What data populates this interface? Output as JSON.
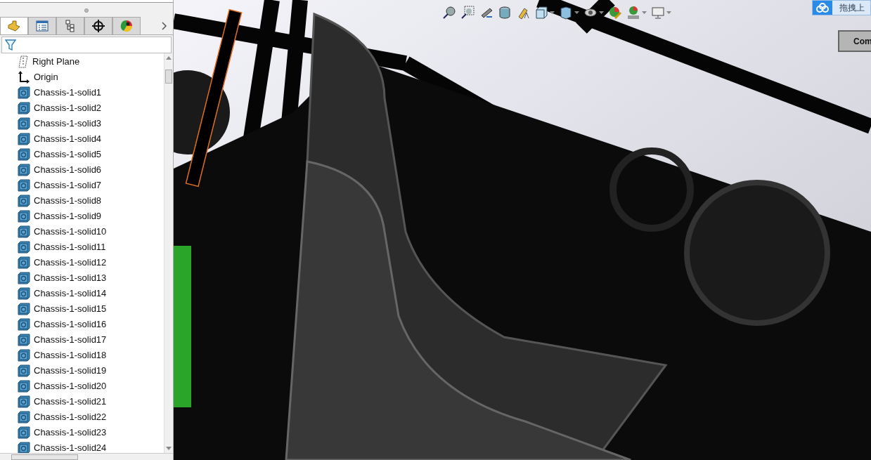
{
  "panel_tabs": [
    {
      "kind": "feature-tree",
      "selected": true
    },
    {
      "kind": "property-manager",
      "selected": false
    },
    {
      "kind": "configuration-manager",
      "selected": false
    },
    {
      "kind": "dimxpert",
      "selected": false
    },
    {
      "kind": "display-manager",
      "selected": false
    }
  ],
  "tree": [
    {
      "kind": "plane",
      "label": "Right Plane"
    },
    {
      "kind": "origin",
      "label": "Origin"
    },
    {
      "kind": "solid",
      "label": "Chassis-1-solid1"
    },
    {
      "kind": "solid",
      "label": "Chassis-1-solid2"
    },
    {
      "kind": "solid",
      "label": "Chassis-1-solid3"
    },
    {
      "kind": "solid",
      "label": "Chassis-1-solid4"
    },
    {
      "kind": "solid",
      "label": "Chassis-1-solid5"
    },
    {
      "kind": "solid",
      "label": "Chassis-1-solid6"
    },
    {
      "kind": "solid",
      "label": "Chassis-1-solid7"
    },
    {
      "kind": "solid",
      "label": "Chassis-1-solid8"
    },
    {
      "kind": "solid",
      "label": "Chassis-1-solid9"
    },
    {
      "kind": "solid",
      "label": "Chassis-1-solid10"
    },
    {
      "kind": "solid",
      "label": "Chassis-1-solid11"
    },
    {
      "kind": "solid",
      "label": "Chassis-1-solid12"
    },
    {
      "kind": "solid",
      "label": "Chassis-1-solid13"
    },
    {
      "kind": "solid",
      "label": "Chassis-1-solid14"
    },
    {
      "kind": "solid",
      "label": "Chassis-1-solid15"
    },
    {
      "kind": "solid",
      "label": "Chassis-1-solid16"
    },
    {
      "kind": "solid",
      "label": "Chassis-1-solid17"
    },
    {
      "kind": "solid",
      "label": "Chassis-1-solid18"
    },
    {
      "kind": "solid",
      "label": "Chassis-1-solid19"
    },
    {
      "kind": "solid",
      "label": "Chassis-1-solid20"
    },
    {
      "kind": "solid",
      "label": "Chassis-1-solid21"
    },
    {
      "kind": "solid",
      "label": "Chassis-1-solid22"
    },
    {
      "kind": "solid",
      "label": "Chassis-1-solid23"
    },
    {
      "kind": "solid",
      "label": "Chassis-1-solid24"
    }
  ],
  "upload_badge": {
    "label": "拖拽上"
  },
  "command_button": {
    "label": "Com"
  }
}
